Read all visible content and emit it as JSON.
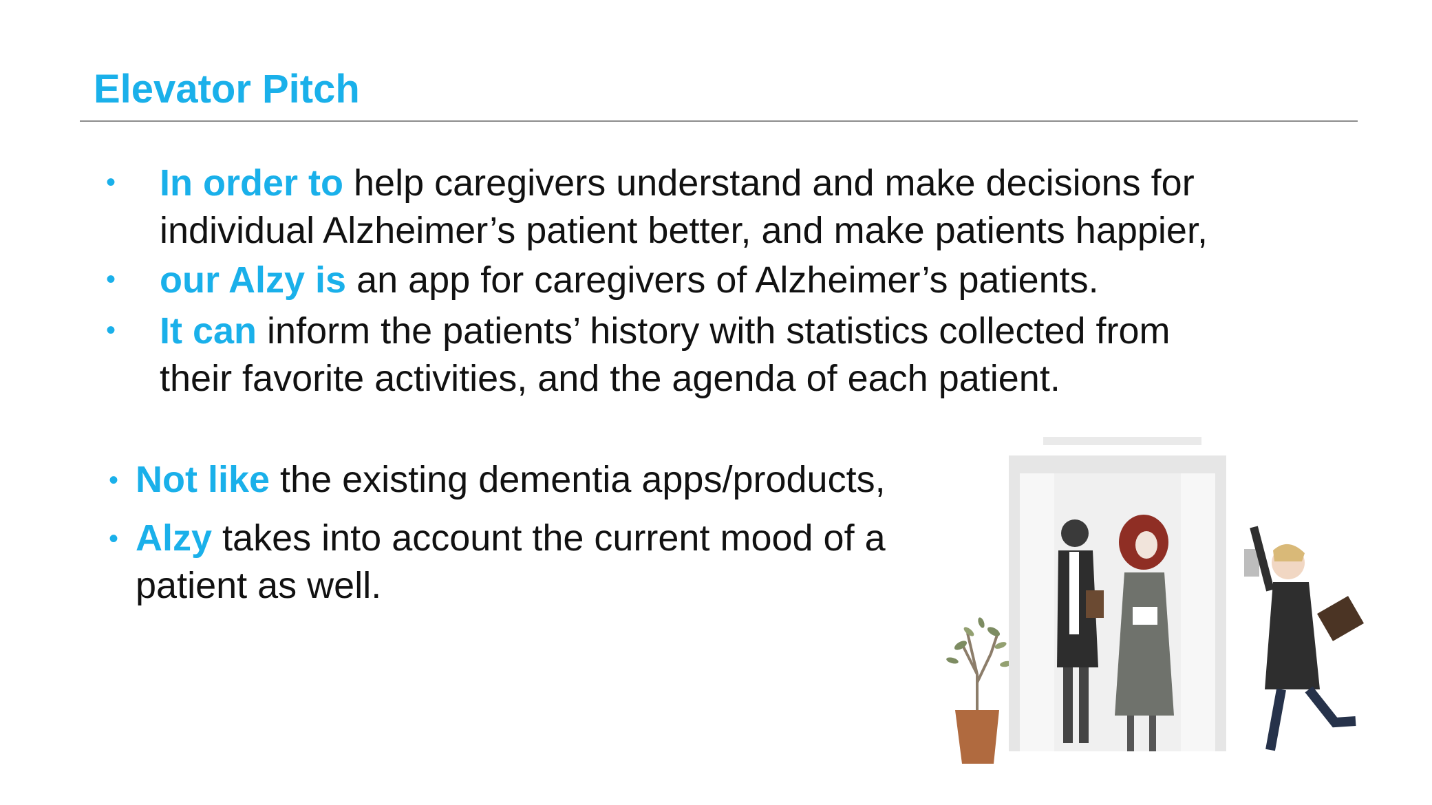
{
  "title": "Elevator Pitch",
  "bullets": [
    {
      "highlight": "In order to",
      "line1": " help caregivers understand and make decisions for",
      "line2": "individual Alzheimer’s patient better, and make patients happier,"
    },
    {
      "highlight": "our Alzy is",
      "line1": " an app for caregivers of Alzheimer’s patients."
    },
    {
      "highlight": "It can",
      "line1": " inform the patients’ history with statistics collected from",
      "line2": "their favorite activities, and the agenda of each patient."
    }
  ],
  "compare": [
    {
      "highlight": "Not like",
      "line1": " the existing dementia apps/products,"
    },
    {
      "highlight": "Alzy",
      "line1": " takes into account the current mood of a",
      "line2": "patient as well."
    }
  ],
  "bullet_glyph": "•",
  "colors": {
    "accent": "#1ab0ea",
    "rule": "#8c8c8c",
    "text": "#111111"
  },
  "illustration": {
    "icon": "elevator-people-illustration"
  }
}
